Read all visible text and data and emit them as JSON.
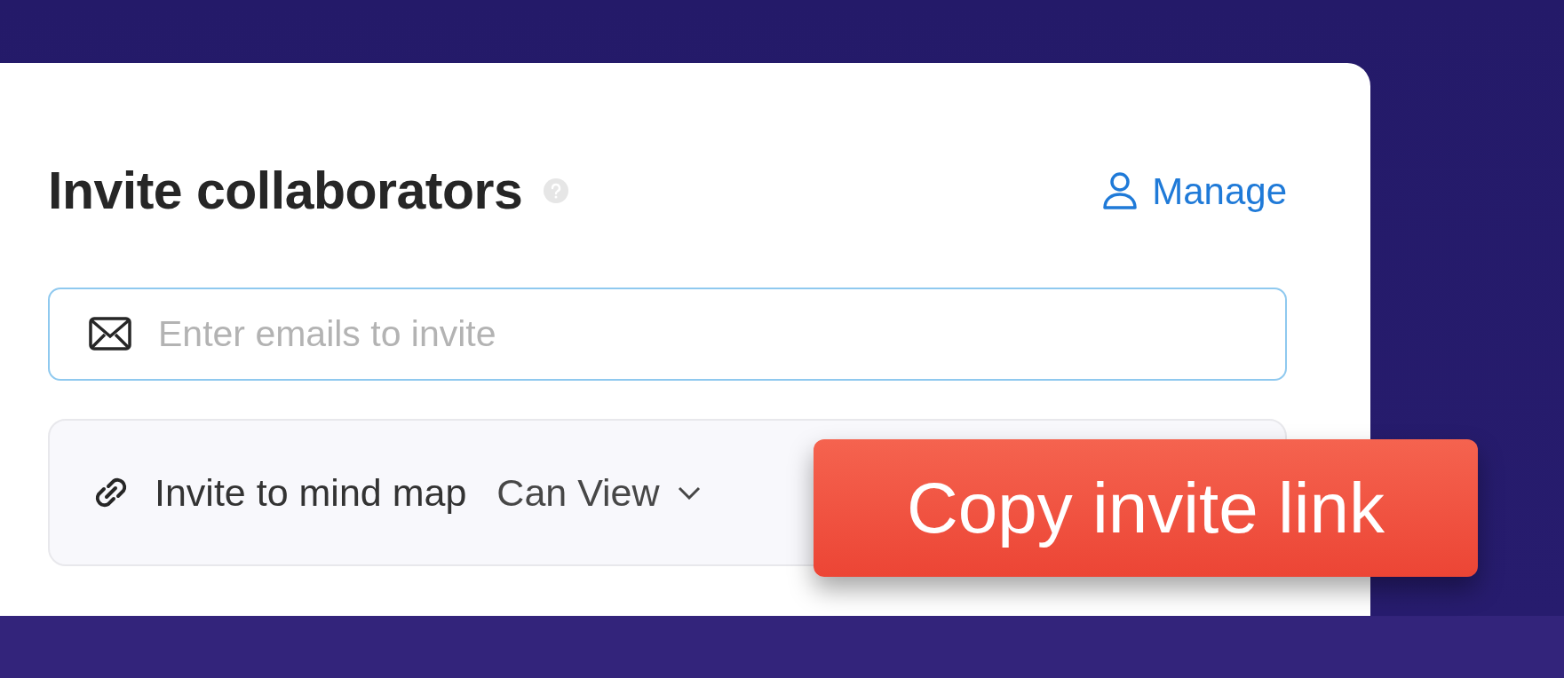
{
  "title": "Invite collaborators",
  "manage_link": {
    "label": "Manage"
  },
  "email_field": {
    "placeholder": "Enter emails to invite"
  },
  "invite_link": {
    "label": "Invite to mind map",
    "permission": "Can View"
  },
  "copy_button": {
    "label": "Copy invite link"
  }
}
